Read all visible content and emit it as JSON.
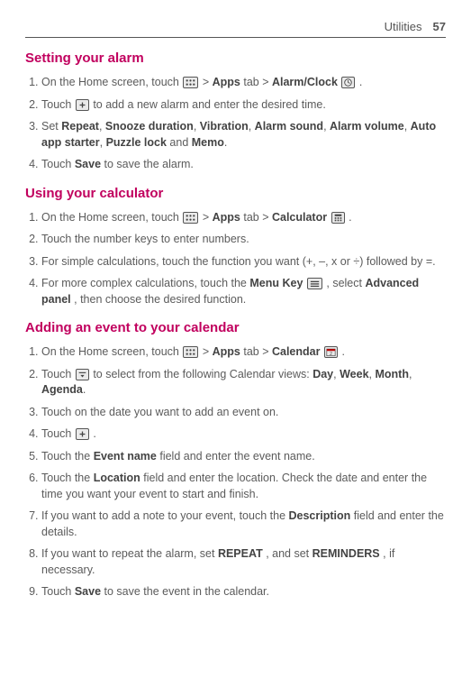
{
  "header": {
    "title": "Utilities",
    "page": "57"
  },
  "section1": {
    "heading": "Setting your alarm",
    "items": {
      "1a": "On the Home screen, touch ",
      "1b": " > ",
      "1c": "Apps",
      "1d": " tab > ",
      "1e": "Alarm/Clock",
      "1f": ".",
      "2a": "Touch ",
      "2b": " to add a new alarm and enter the desired time.",
      "3a": "Set ",
      "3b": "Repeat",
      "3c": ", ",
      "3d": "Snooze duration",
      "3e": ", ",
      "3f": "Vibration",
      "3g": ", ",
      "3h": "Alarm sound",
      "3i": ", ",
      "3j": "Alarm volume",
      "3k": ", ",
      "3l": "Auto app starter",
      "3m": ", ",
      "3n": "Puzzle lock",
      "3o": " and ",
      "3p": "Memo",
      "3q": ".",
      "4a": "Touch ",
      "4b": "Save",
      "4c": " to save the alarm."
    }
  },
  "section2": {
    "heading": "Using your calculator",
    "items": {
      "1a": "On the Home screen, touch ",
      "1b": " > ",
      "1c": "Apps",
      "1d": " tab > ",
      "1e": "Calculator",
      "1f": ".",
      "2": "Touch the number keys to enter numbers.",
      "3": "For simple calculations, touch the function you want (+, –, x or ÷) followed by =.",
      "4a": "For more complex calculations, touch the ",
      "4b": "Menu Key",
      "4c": " ",
      "4d": ", select ",
      "4e": "Advanced panel",
      "4f": ", then choose the desired function."
    }
  },
  "section3": {
    "heading": "Adding an event to your calendar",
    "items": {
      "1a": "On the Home screen, touch ",
      "1b": " > ",
      "1c": "Apps",
      "1d": " tab > ",
      "1e": "Calendar",
      "1f": ".",
      "2a": "Touch ",
      "2b": " to select from the following Calendar views: ",
      "2c": "Day",
      "2d": ", ",
      "2e": "Week",
      "2f": ", ",
      "2g": "Month",
      "2h": ", ",
      "2i": "Agenda",
      "2j": ".",
      "3": "Touch on the date you want to add an event on.",
      "4a": "Touch ",
      "4b": ".",
      "5a": "Touch the ",
      "5b": "Event name",
      "5c": " field and enter the event name.",
      "6a": "Touch the ",
      "6b": "Location",
      "6c": " field and enter the location. Check the date and enter the time you want your event to start and finish.",
      "7a": "If you want to add a note to your event, touch the ",
      "7b": "Description",
      "7c": " field and enter the details.",
      "8a": "If you want to repeat the alarm, set ",
      "8b": "REPEAT",
      "8c": ", and set ",
      "8d": "REMINDERS",
      "8e": ", if necessary.",
      "9a": "Touch ",
      "9b": "Save",
      "9c": " to save the event in the calendar."
    }
  }
}
